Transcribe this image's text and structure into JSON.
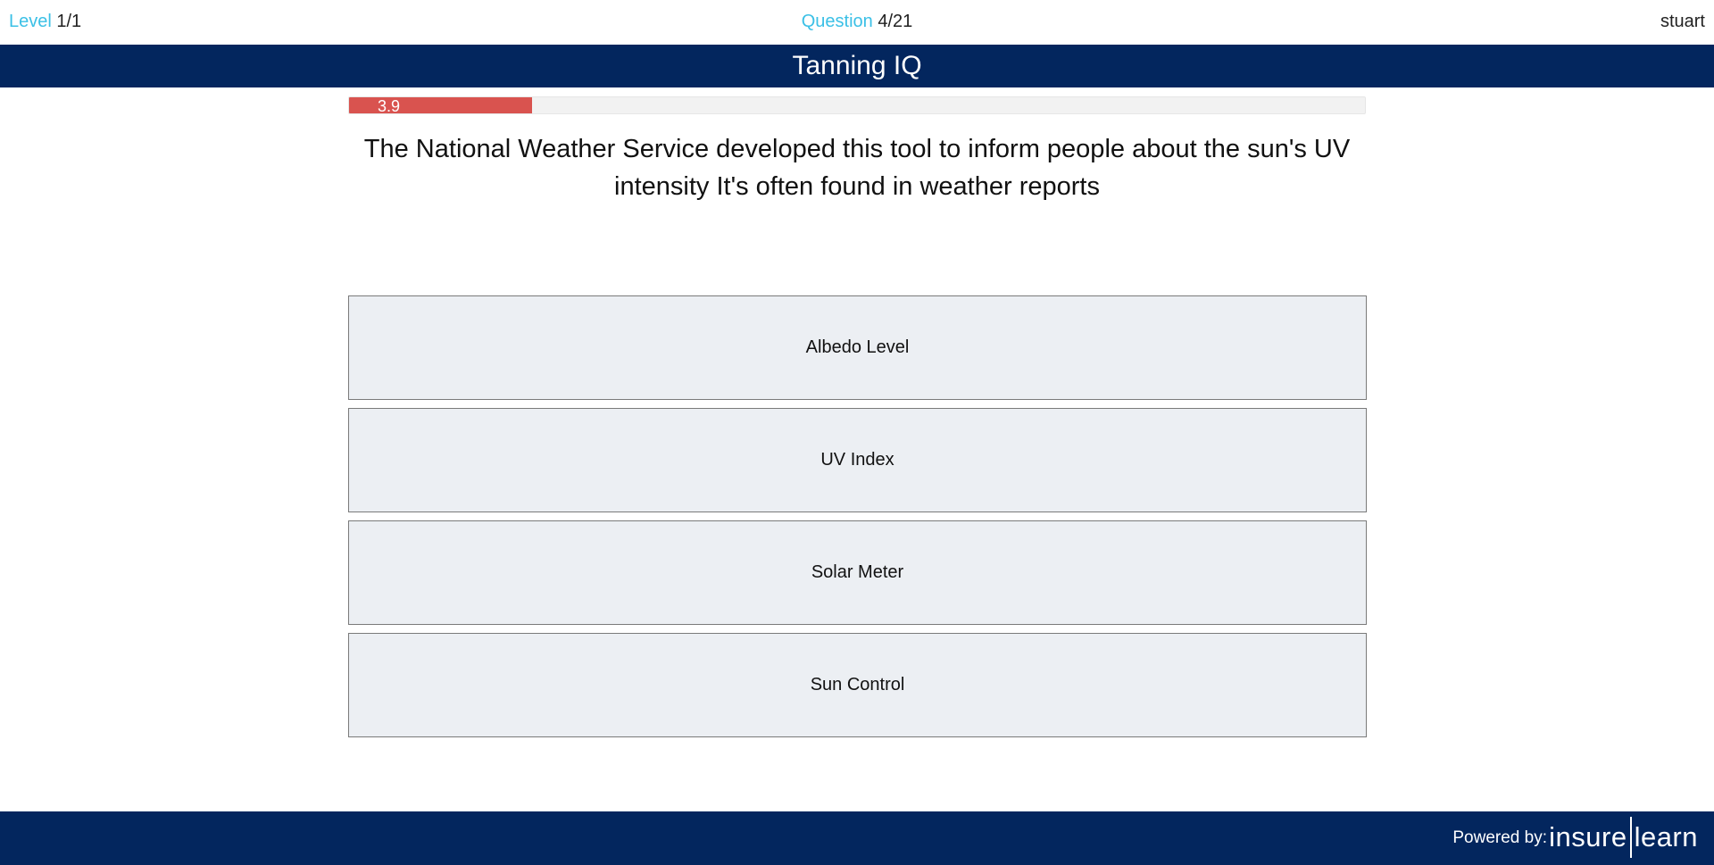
{
  "header": {
    "level_label": "Level",
    "level_value": "1/1",
    "question_label": "Question",
    "question_value": "4/21",
    "username": "stuart"
  },
  "quiz": {
    "title": "Tanning IQ",
    "timer_value": "3.9",
    "timer_fraction": 0.18,
    "question": "The National Weather Service developed this tool to inform people about the sun's UV intensity It's often found in weather reports",
    "answers": [
      "Albedo Level",
      "UV Index",
      "Solar Meter",
      "Sun Control"
    ]
  },
  "footer": {
    "powered_by": "Powered by:",
    "logo_left": "insure",
    "logo_right": "learn"
  },
  "colors": {
    "brand_navy": "#03265e",
    "accent_cyan": "#3bc0e6",
    "timer_red": "#d9534f",
    "answer_bg": "#eceff3"
  }
}
